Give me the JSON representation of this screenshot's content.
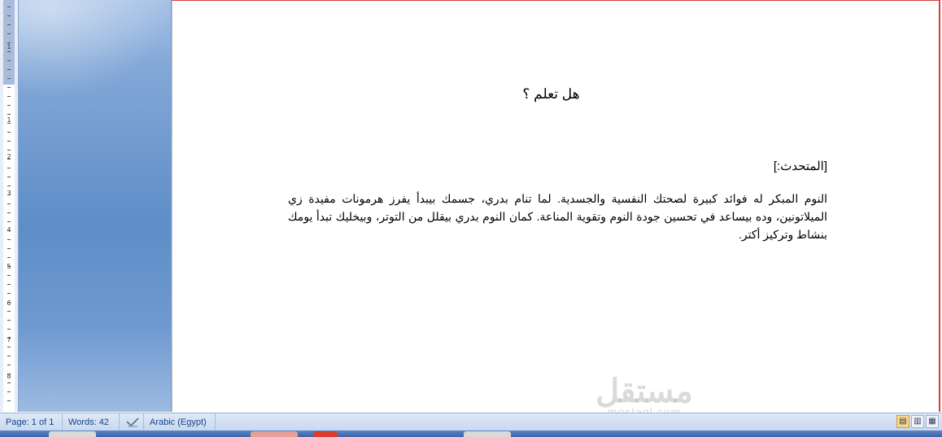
{
  "document": {
    "title": "هل تعلم ؟",
    "speaker_label": "[المتحدث:]",
    "paragraph": "النوم المبكر له فوائد كبيرة لصحتك النفسية والجسدية. لما تنام بدري، جسمك بيبدأ يفرز هرمونات مفيدة زي الميلاتونين، وده بيساعد في تحسين جودة النوم وتقوية المناعة. كمان النوم بدري بيقلل من التوتر، وبيخليك تبدأ يومك بنشاط وتركيز أكتر."
  },
  "ruler": {
    "numbers": [
      "1",
      "1",
      "2",
      "3",
      "4",
      "5",
      "6",
      "7",
      "8"
    ]
  },
  "status_bar": {
    "page": "Page: 1 of 1",
    "words": "Words: 42",
    "proofing_icon": "spelling-check-icon",
    "language": "Arabic (Egypt)",
    "views": [
      "print-layout-icon",
      "full-screen-reading-icon",
      "web-layout-icon"
    ]
  },
  "watermark": {
    "logo": "مستقل",
    "sub": "mostaql.com"
  },
  "colors": {
    "status_text": "#15428b",
    "page_border": "#d04040",
    "background_blue": "#5e8dc7"
  }
}
